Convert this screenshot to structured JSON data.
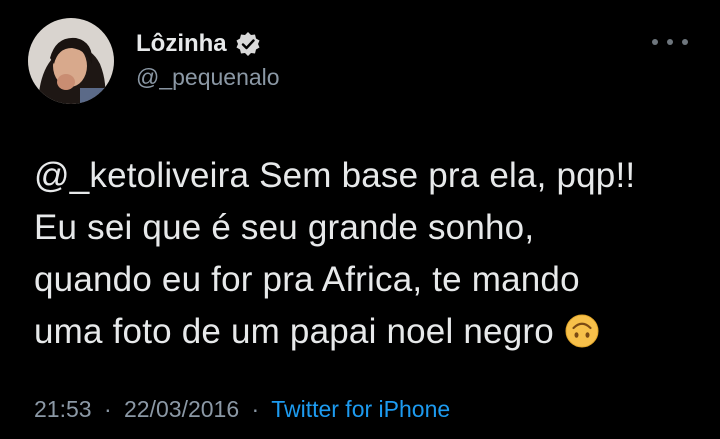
{
  "tweet": {
    "display_name": "Lôzinha",
    "handle": "@_pequenalo",
    "text_mention": "@_ketoliveira",
    "text_lines": [
      " Sem base pra ela, pqp!!",
      "Eu sei que é seu grande sonho,",
      "quando eu for pra Africa, te mando",
      "uma foto de um papai noel negro"
    ],
    "emoji": "upside-down-face-icon",
    "time": "21:53",
    "separator": "·",
    "date": "22/03/2016",
    "source": "Twitter for iPhone"
  },
  "icons": {
    "verified": "verified-badge-icon",
    "more": "more-options-icon",
    "avatar": "avatar"
  },
  "colors": {
    "background": "#000000",
    "text": "#e7e9ea",
    "secondary": "#8b98a5",
    "accent": "#1d9bf0",
    "emoji": "#f7c04a"
  }
}
